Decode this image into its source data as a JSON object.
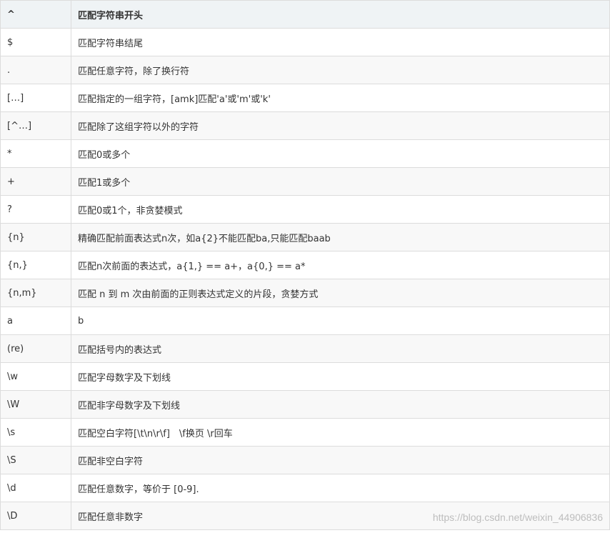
{
  "table": {
    "header": {
      "pattern": "^",
      "description": "匹配字符串开头"
    },
    "rows": [
      {
        "pattern": "$",
        "description": "匹配字符串结尾"
      },
      {
        "pattern": ".",
        "description": "匹配任意字符，除了换行符"
      },
      {
        "pattern": "[…]",
        "description": "匹配指定的一组字符，[amk]匹配'a'或'm'或'k'"
      },
      {
        "pattern": "[^…]",
        "description": "匹配除了这组字符以外的字符"
      },
      {
        "pattern": "*",
        "description": "匹配0或多个"
      },
      {
        "pattern": "+",
        "description": "匹配1或多个"
      },
      {
        "pattern": "?",
        "description": "匹配0或1个，非贪婪模式"
      },
      {
        "pattern": "{n}",
        "description": "精确匹配前面表达式n次，如a{2}不能匹配ba,只能匹配baab"
      },
      {
        "pattern": "{n,}",
        "description": "匹配n次前面的表达式，a{1,} == a+，a{0,} == a*"
      },
      {
        "pattern": "{n,m}",
        "description": "匹配 n 到 m 次由前面的正则表达式定义的片段，贪婪方式"
      },
      {
        "pattern": "a",
        "description": "b"
      },
      {
        "pattern": "(re)",
        "description": "匹配括号内的表达式"
      },
      {
        "pattern": "\\w",
        "description": "匹配字母数字及下划线"
      },
      {
        "pattern": "\\W",
        "description": "匹配非字母数字及下划线"
      },
      {
        "pattern": "\\s",
        "description": "匹配空白字符[\\t\\n\\r\\f]　\\f换页 \\r回车"
      },
      {
        "pattern": "\\S",
        "description": "匹配非空白字符"
      },
      {
        "pattern": "\\d",
        "description": "匹配任意数字，等价于 [0-9]."
      },
      {
        "pattern": "\\D",
        "description": "匹配任意非数字"
      }
    ]
  },
  "watermark": "https://blog.csdn.net/weixin_44906836"
}
